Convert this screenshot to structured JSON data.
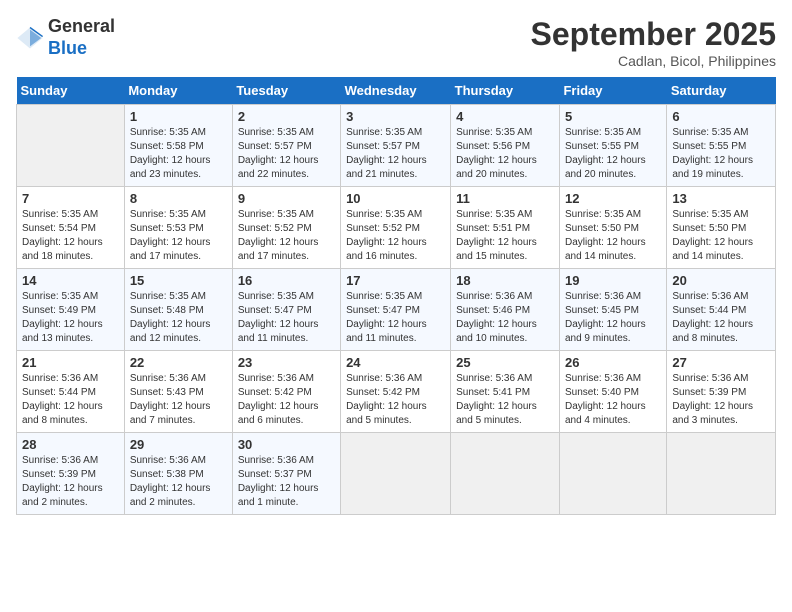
{
  "logo": {
    "general": "General",
    "blue": "Blue"
  },
  "title": "September 2025",
  "subtitle": "Cadlan, Bicol, Philippines",
  "weekdays": [
    "Sunday",
    "Monday",
    "Tuesday",
    "Wednesday",
    "Thursday",
    "Friday",
    "Saturday"
  ],
  "weeks": [
    [
      {
        "day": "",
        "info": ""
      },
      {
        "day": "1",
        "info": "Sunrise: 5:35 AM\nSunset: 5:58 PM\nDaylight: 12 hours\nand 23 minutes."
      },
      {
        "day": "2",
        "info": "Sunrise: 5:35 AM\nSunset: 5:57 PM\nDaylight: 12 hours\nand 22 minutes."
      },
      {
        "day": "3",
        "info": "Sunrise: 5:35 AM\nSunset: 5:57 PM\nDaylight: 12 hours\nand 21 minutes."
      },
      {
        "day": "4",
        "info": "Sunrise: 5:35 AM\nSunset: 5:56 PM\nDaylight: 12 hours\nand 20 minutes."
      },
      {
        "day": "5",
        "info": "Sunrise: 5:35 AM\nSunset: 5:55 PM\nDaylight: 12 hours\nand 20 minutes."
      },
      {
        "day": "6",
        "info": "Sunrise: 5:35 AM\nSunset: 5:55 PM\nDaylight: 12 hours\nand 19 minutes."
      }
    ],
    [
      {
        "day": "7",
        "info": "Sunrise: 5:35 AM\nSunset: 5:54 PM\nDaylight: 12 hours\nand 18 minutes."
      },
      {
        "day": "8",
        "info": "Sunrise: 5:35 AM\nSunset: 5:53 PM\nDaylight: 12 hours\nand 17 minutes."
      },
      {
        "day": "9",
        "info": "Sunrise: 5:35 AM\nSunset: 5:52 PM\nDaylight: 12 hours\nand 17 minutes."
      },
      {
        "day": "10",
        "info": "Sunrise: 5:35 AM\nSunset: 5:52 PM\nDaylight: 12 hours\nand 16 minutes."
      },
      {
        "day": "11",
        "info": "Sunrise: 5:35 AM\nSunset: 5:51 PM\nDaylight: 12 hours\nand 15 minutes."
      },
      {
        "day": "12",
        "info": "Sunrise: 5:35 AM\nSunset: 5:50 PM\nDaylight: 12 hours\nand 14 minutes."
      },
      {
        "day": "13",
        "info": "Sunrise: 5:35 AM\nSunset: 5:50 PM\nDaylight: 12 hours\nand 14 minutes."
      }
    ],
    [
      {
        "day": "14",
        "info": "Sunrise: 5:35 AM\nSunset: 5:49 PM\nDaylight: 12 hours\nand 13 minutes."
      },
      {
        "day": "15",
        "info": "Sunrise: 5:35 AM\nSunset: 5:48 PM\nDaylight: 12 hours\nand 12 minutes."
      },
      {
        "day": "16",
        "info": "Sunrise: 5:35 AM\nSunset: 5:47 PM\nDaylight: 12 hours\nand 11 minutes."
      },
      {
        "day": "17",
        "info": "Sunrise: 5:35 AM\nSunset: 5:47 PM\nDaylight: 12 hours\nand 11 minutes."
      },
      {
        "day": "18",
        "info": "Sunrise: 5:36 AM\nSunset: 5:46 PM\nDaylight: 12 hours\nand 10 minutes."
      },
      {
        "day": "19",
        "info": "Sunrise: 5:36 AM\nSunset: 5:45 PM\nDaylight: 12 hours\nand 9 minutes."
      },
      {
        "day": "20",
        "info": "Sunrise: 5:36 AM\nSunset: 5:44 PM\nDaylight: 12 hours\nand 8 minutes."
      }
    ],
    [
      {
        "day": "21",
        "info": "Sunrise: 5:36 AM\nSunset: 5:44 PM\nDaylight: 12 hours\nand 8 minutes."
      },
      {
        "day": "22",
        "info": "Sunrise: 5:36 AM\nSunset: 5:43 PM\nDaylight: 12 hours\nand 7 minutes."
      },
      {
        "day": "23",
        "info": "Sunrise: 5:36 AM\nSunset: 5:42 PM\nDaylight: 12 hours\nand 6 minutes."
      },
      {
        "day": "24",
        "info": "Sunrise: 5:36 AM\nSunset: 5:42 PM\nDaylight: 12 hours\nand 5 minutes."
      },
      {
        "day": "25",
        "info": "Sunrise: 5:36 AM\nSunset: 5:41 PM\nDaylight: 12 hours\nand 5 minutes."
      },
      {
        "day": "26",
        "info": "Sunrise: 5:36 AM\nSunset: 5:40 PM\nDaylight: 12 hours\nand 4 minutes."
      },
      {
        "day": "27",
        "info": "Sunrise: 5:36 AM\nSunset: 5:39 PM\nDaylight: 12 hours\nand 3 minutes."
      }
    ],
    [
      {
        "day": "28",
        "info": "Sunrise: 5:36 AM\nSunset: 5:39 PM\nDaylight: 12 hours\nand 2 minutes."
      },
      {
        "day": "29",
        "info": "Sunrise: 5:36 AM\nSunset: 5:38 PM\nDaylight: 12 hours\nand 2 minutes."
      },
      {
        "day": "30",
        "info": "Sunrise: 5:36 AM\nSunset: 5:37 PM\nDaylight: 12 hours\nand 1 minute."
      },
      {
        "day": "",
        "info": ""
      },
      {
        "day": "",
        "info": ""
      },
      {
        "day": "",
        "info": ""
      },
      {
        "day": "",
        "info": ""
      }
    ]
  ]
}
